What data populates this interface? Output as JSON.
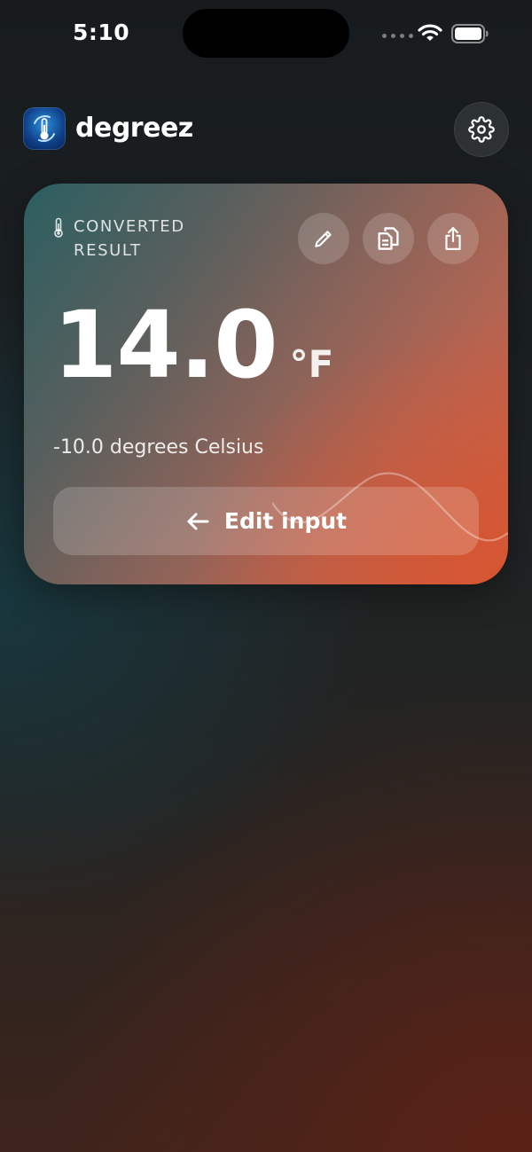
{
  "status_bar": {
    "time": "5:10"
  },
  "header": {
    "app_name": "degreez",
    "logo_icon": "thermometer-cycle-icon",
    "settings_icon": "gear-icon"
  },
  "result": {
    "label": "CONVERTED RESULT",
    "value": "14.0",
    "unit": "°F",
    "description": "-10.0 degrees Celsius",
    "edit_button_label": "Edit input",
    "actions": [
      "pencil-icon",
      "copy-icon",
      "share-icon"
    ]
  },
  "colors": {
    "card_start": "#2c5f61",
    "card_end": "#d35f3f",
    "logo": "#1f6fd0"
  }
}
